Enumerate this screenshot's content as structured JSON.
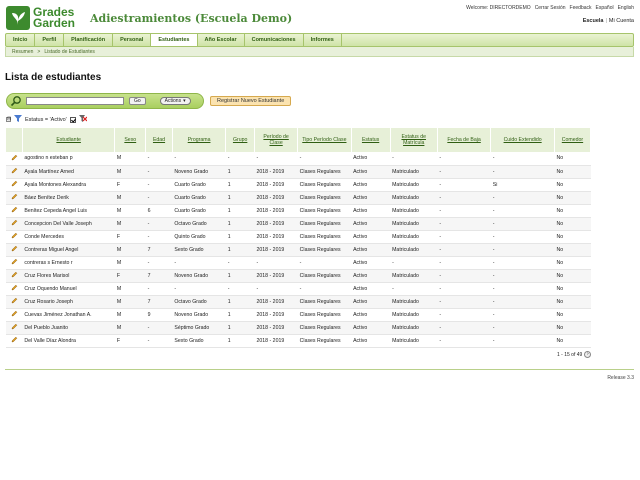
{
  "brand": {
    "line1": "Grades",
    "line2": "Garden"
  },
  "app_title": "Adiestramientos (Escuela Demo)",
  "top_links": [
    "Welcome: DIRECTORDEMO",
    "Cerrar Sesión",
    "Feedback",
    "Español",
    "English"
  ],
  "account": {
    "school": "Escuela",
    "separator": "|",
    "my_account": "Mi Cuenta"
  },
  "nav": [
    {
      "label": "Inicio"
    },
    {
      "label": "Perfil"
    },
    {
      "label": "Planificación"
    },
    {
      "label": "Personal"
    },
    {
      "label": "Estudiantes"
    },
    {
      "label": "Año Escolar"
    },
    {
      "label": "Comunicaciones"
    },
    {
      "label": "Informes"
    }
  ],
  "nav_active": "Estudiantes",
  "breadcrumb": {
    "root": "Resumen",
    "separator": ">",
    "current": "Listado de Estudiantes"
  },
  "page_title": "Lista de estudiantes",
  "search": {
    "value": "",
    "go_label": "Go",
    "actions_label": "Actions",
    "actions_arrow": "▾"
  },
  "register_button": "Registrar Nuevo Estudiante",
  "filter": {
    "label": "Estatus = 'Activo'",
    "checked": true,
    "toggle": "⊟"
  },
  "columns": [
    "Estudiante",
    "Sexo",
    "Edad",
    "Programa",
    "Grupo",
    "Período de Clase",
    "Tipo Período Clase",
    "Estatus",
    "Estatus de Matrícula",
    "Fecha de Baja",
    "Cuido Extendido",
    "Comedor"
  ],
  "rows": [
    [
      "agostino n esteban p",
      "M",
      "-",
      "-",
      "-",
      "-",
      "-",
      "Activo",
      "-",
      "-",
      "-",
      "No"
    ],
    [
      "Ayala Martínez Arned",
      "M",
      "-",
      "Noveno Grado",
      "1",
      "2018 - 2019",
      "Clases Regulares",
      "Activo",
      "Matriculado",
      "-",
      "-",
      "No"
    ],
    [
      "Ayala Montones Alexandra",
      "F",
      "-",
      "Cuarto Grado",
      "1",
      "2018 - 2019",
      "Clases Regulares",
      "Activo",
      "Matriculado",
      "-",
      "Si",
      "No"
    ],
    [
      "Báez Benítez Derik",
      "M",
      "-",
      "Cuarto Grado",
      "1",
      "2018 - 2019",
      "Clases Regulares",
      "Activo",
      "Matriculado",
      "-",
      "-",
      "No"
    ],
    [
      "Benítez Cepeda Angel Luis",
      "M",
      "6",
      "Cuarto Grado",
      "1",
      "2018 - 2019",
      "Clases Regulares",
      "Activo",
      "Matriculado",
      "-",
      "-",
      "No"
    ],
    [
      "Concepcion Del Valle Joseph",
      "M",
      "-",
      "Octavo Grado",
      "1",
      "2018 - 2019",
      "Clases Regulares",
      "Activo",
      "Matriculado",
      "-",
      "-",
      "No"
    ],
    [
      "Conde Mercedes",
      "F",
      "-",
      "Quinto Grado",
      "1",
      "2018 - 2019",
      "Clases Regulares",
      "Activo",
      "Matriculado",
      "-",
      "-",
      "No"
    ],
    [
      "Contreras Miguel Angel",
      "M",
      "7",
      "Sexto Grado",
      "1",
      "2018 - 2019",
      "Clases Regulares",
      "Activo",
      "Matriculado",
      "-",
      "-",
      "No"
    ],
    [
      "contreras s Ernesto r",
      "M",
      "-",
      "-",
      "-",
      "-",
      "-",
      "Activo",
      "-",
      "-",
      "-",
      "No"
    ],
    [
      "Cruz Flores Marisol",
      "F",
      "7",
      "Noveno Grado",
      "1",
      "2018 - 2019",
      "Clases Regulares",
      "Activo",
      "Matriculado",
      "-",
      "-",
      "No"
    ],
    [
      "Cruz Oquendo Manuel",
      "M",
      "-",
      "-",
      "-",
      "-",
      "-",
      "Activo",
      "-",
      "-",
      "-",
      "No"
    ],
    [
      "Cruz Rosario Joseph",
      "M",
      "7",
      "Octavo Grado",
      "1",
      "2018 - 2019",
      "Clases Regulares",
      "Activo",
      "Matriculado",
      "-",
      "-",
      "No"
    ],
    [
      "Cuevas Jiménez Jonathan A.",
      "M",
      "9",
      "Noveno Grado",
      "1",
      "2018 - 2019",
      "Clases Regulares",
      "Activo",
      "Matriculado",
      "-",
      "-",
      "No"
    ],
    [
      "Del Pueblo Juanito",
      "M",
      "-",
      "Séptimo Grado",
      "1",
      "2018 - 2019",
      "Clases Regulares",
      "Activo",
      "Matriculado",
      "-",
      "-",
      "No"
    ],
    [
      "Del Valle Díaz Alondra",
      "F",
      "-",
      "Sexto Grado",
      "1",
      "2018 - 2019",
      "Clases Regulares",
      "Activo",
      "Matriculado",
      "-",
      "-",
      "No"
    ]
  ],
  "pager": {
    "text": "1 - 15 of 49",
    "next": "›"
  },
  "release": "Release 3.3",
  "colors": {
    "brand_green": "#3d8a2e",
    "nav_bg": "#cfe3a7",
    "header_row": "#e7f0d8",
    "register_btn": "#fbe3b0"
  }
}
